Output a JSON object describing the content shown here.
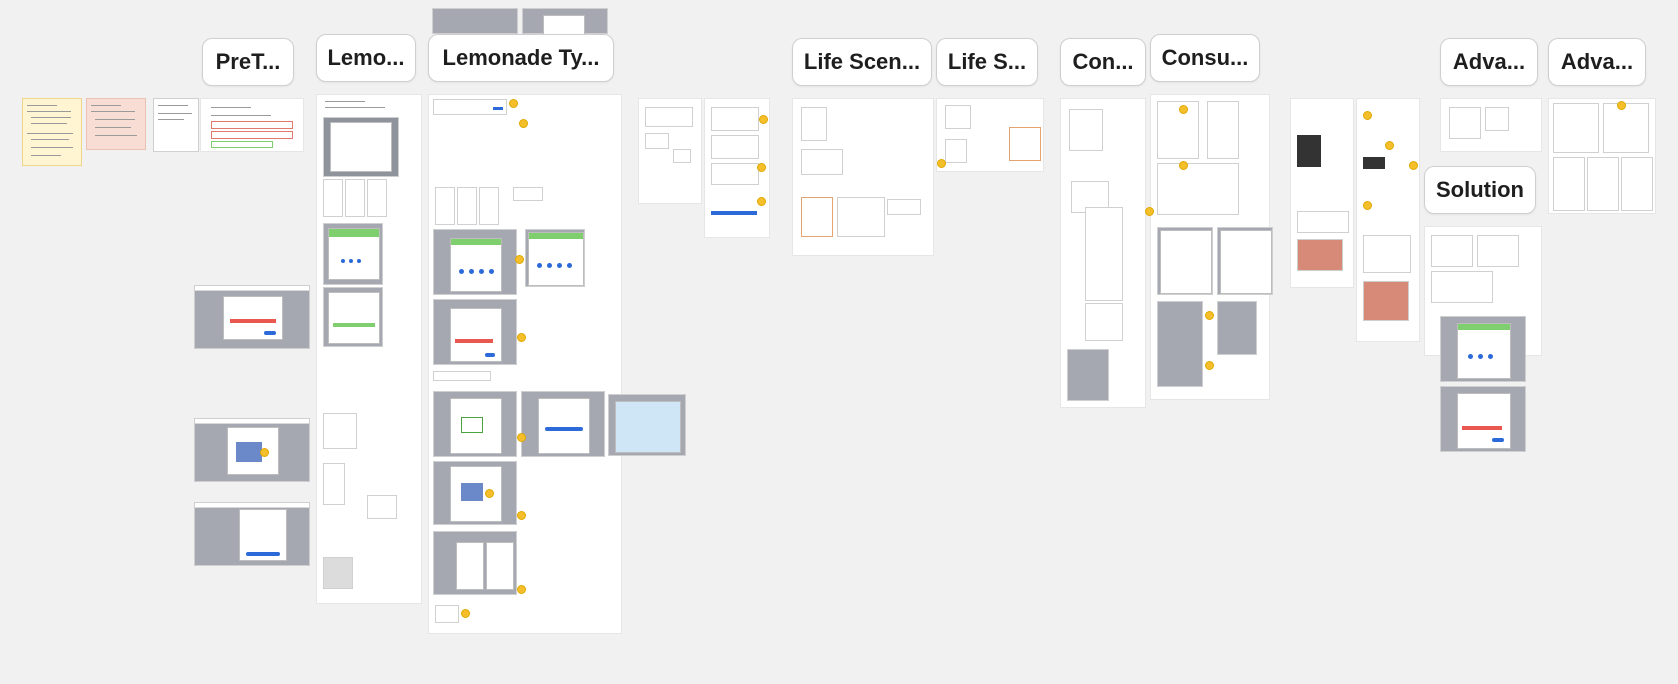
{
  "canvas": {
    "background": "#f1f1f1"
  },
  "section_labels": [
    {
      "id": "pretest",
      "text": "PreT..."
    },
    {
      "id": "lemonade-short",
      "text": "Lemo..."
    },
    {
      "id": "lemonade-ty",
      "text": "Lemonade Ty..."
    },
    {
      "id": "life-scen",
      "text": "Life Scen..."
    },
    {
      "id": "life-s",
      "text": "Life S..."
    },
    {
      "id": "con",
      "text": "Con..."
    },
    {
      "id": "consu",
      "text": "Consu..."
    },
    {
      "id": "adva-1",
      "text": "Adva..."
    },
    {
      "id": "adva-2",
      "text": "Adva..."
    },
    {
      "id": "solution",
      "text": "Solution"
    }
  ],
  "colors": {
    "accent_blue": "#2b6ad8",
    "comment_dot": "#f4bf2a",
    "frame_gray": "#a6a8b1",
    "success_green": "#7fcf6f",
    "error_red": "#e8584f"
  }
}
